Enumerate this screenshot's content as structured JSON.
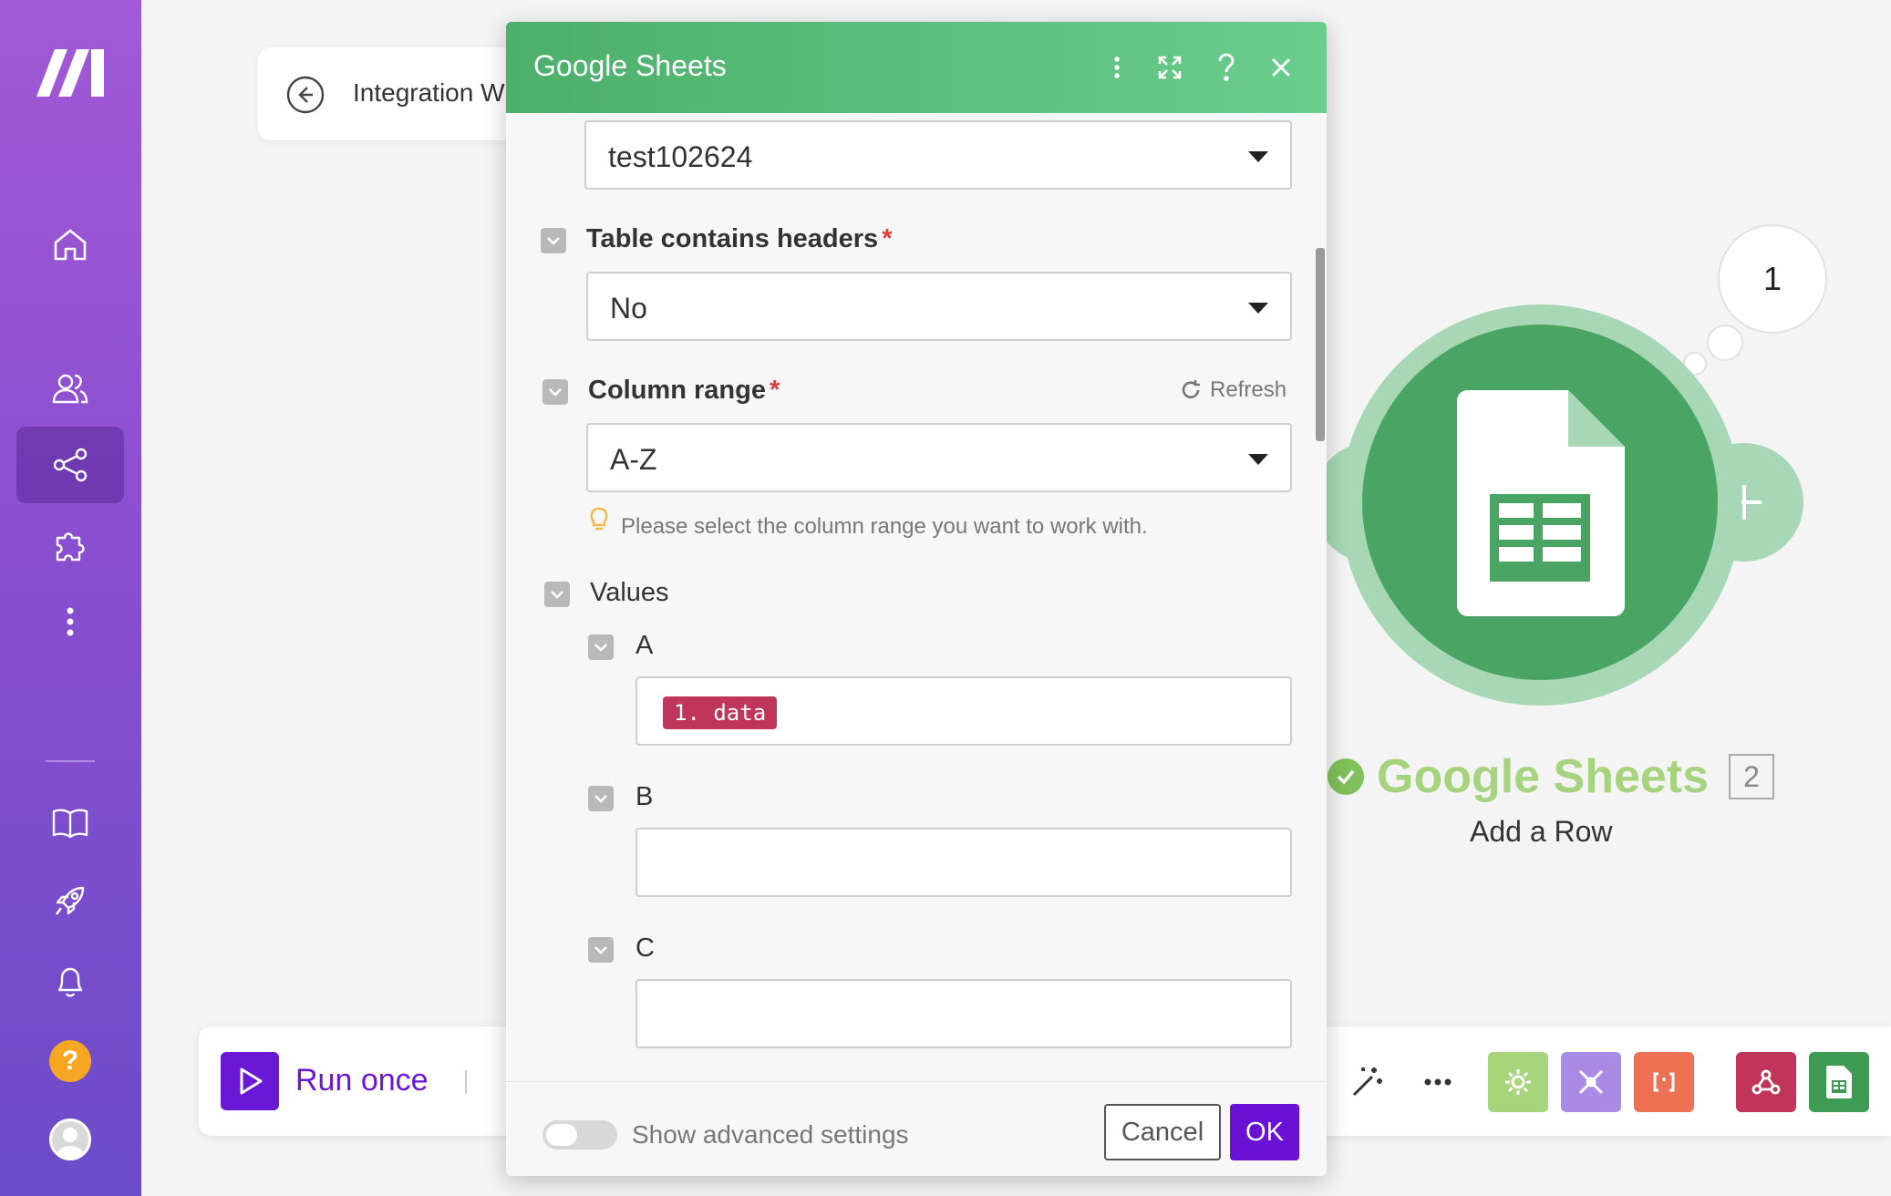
{
  "breadcrumb": {
    "text": "Integration W"
  },
  "toolbar": {
    "run_label": "Run once"
  },
  "dialog": {
    "title": "Google Sheets",
    "sheet_select_value": "test102624",
    "headers_label": "Table contains headers",
    "headers_value": "No",
    "column_range_label": "Column range",
    "refresh_label": "Refresh",
    "column_range_value": "A-Z",
    "column_range_hint": "Please select the column range you want to work with.",
    "values_label": "Values",
    "columns": [
      {
        "label": "A",
        "mapped_pill": "1. data"
      },
      {
        "label": "B"
      },
      {
        "label": "C"
      }
    ],
    "required_mark": "*",
    "advanced_label": "Show advanced settings",
    "cancel_label": "Cancel",
    "ok_label": "OK"
  },
  "module": {
    "operations_bubble": "1",
    "title": "Google Sheets",
    "badge": "2",
    "subtitle": "Add a Row"
  },
  "sidebar": {
    "help_glyph": "?"
  },
  "colors": {
    "sidebar_top": "#a159d6",
    "sidebar_bottom": "#6b4cc9",
    "dialog_header": "#4caf6a",
    "primary": "#6b11d6",
    "module_green": "#4aa564",
    "module_title": "#a5d37e",
    "pill": "#c0365a"
  }
}
